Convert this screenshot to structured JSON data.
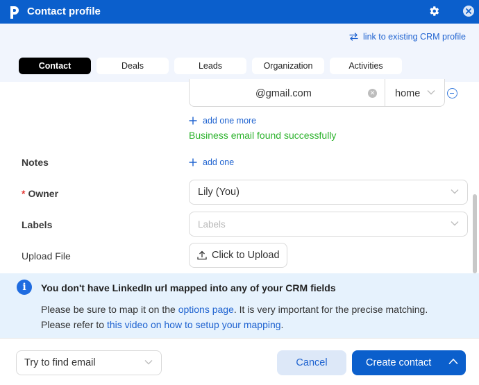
{
  "window": {
    "title": "Contact profile",
    "logo_icon": "pipedrive-p-logo",
    "settings_icon": "gear-icon",
    "close_icon": "close-icon"
  },
  "header": {
    "crm_link": "link to existing CRM profile",
    "tabs": [
      {
        "label": "Contact",
        "active": true
      },
      {
        "label": "Deals",
        "active": false
      },
      {
        "label": "Leads",
        "active": false
      },
      {
        "label": "Organization",
        "active": false
      },
      {
        "label": "Activities",
        "active": false
      }
    ]
  },
  "form": {
    "email": {
      "value": "@gmail.com",
      "type": "home"
    },
    "add_one_more": "add one more",
    "success_message": "Business email found successfully",
    "notes": {
      "label": "Notes",
      "add": "add one"
    },
    "owner": {
      "required_mark": "*",
      "label": "Owner",
      "value": "Lily (You)"
    },
    "labels": {
      "label": "Labels",
      "placeholder": "Labels"
    },
    "upload": {
      "label": "Upload File",
      "button": "Click to Upload"
    }
  },
  "info": {
    "title": "You don't have LinkedIn url mapped into any of your CRM fields",
    "line1_prefix": "Please be sure to map it on the ",
    "line1_link": "options page",
    "line1_suffix": ". It is very important for the precise matching.",
    "line2_prefix": "Please refer to ",
    "line2_link": "this video on how to setup your mapping",
    "line2_suffix": "."
  },
  "footer": {
    "find_select": "Try to find email",
    "cancel": "Cancel",
    "create": "Create contact"
  },
  "colors": {
    "brand": "#0b5fcc",
    "link": "#1f63d0",
    "success": "#2bb22b",
    "required": "#e53935",
    "info_bg": "#e6f2fd"
  }
}
